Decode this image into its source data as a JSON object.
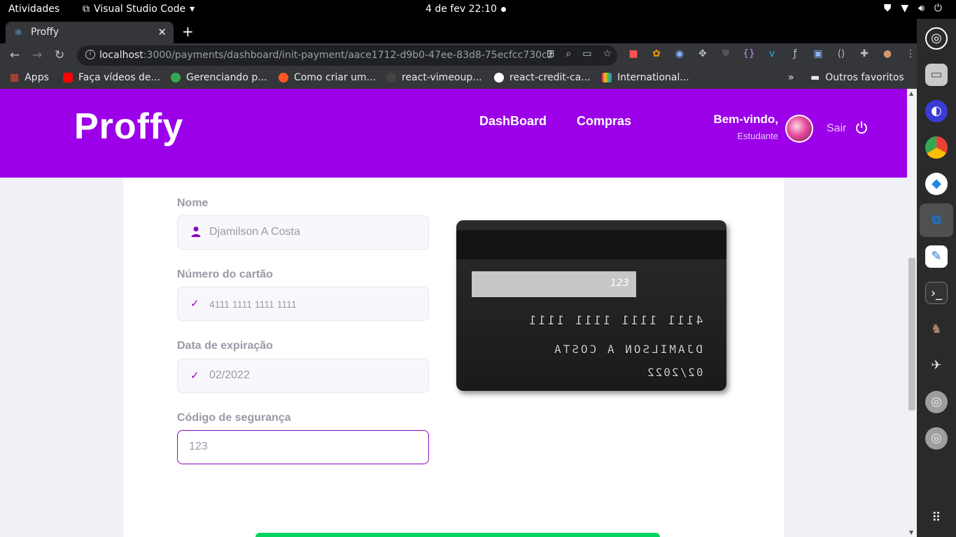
{
  "topbar": {
    "activities": "Atividades",
    "app_name": "Visual Studio Code",
    "clock": "4 de fev  22:10"
  },
  "browser": {
    "tab_title": "Proffy",
    "url_host": "localhost",
    "url_path": ":3000/payments/dashboard/init-payment/aace1712-d9b0-47ee-83d8-75ecfcc730c2",
    "bookmarks": [
      {
        "label": "Apps",
        "color": "#e8eaed"
      },
      {
        "label": "Faça vídeos de...",
        "color": "#ff0000"
      },
      {
        "label": "Gerenciando p...",
        "color": "#34a853"
      },
      {
        "label": "Como criar um...",
        "color": "#ff5722"
      },
      {
        "label": "react-vimeoup...",
        "color": "#444444"
      },
      {
        "label": "react-credit-ca...",
        "color": "#ffffff"
      },
      {
        "label": "International...",
        "color": "#e91e63"
      }
    ],
    "other_bookmarks": "Outros favoritos",
    "more": "»"
  },
  "header": {
    "logo": "Proffy",
    "nav": {
      "dashboard": "DashBoard",
      "purchases": "Compras"
    },
    "welcome": "Bem-vindo,",
    "role": "Estudante",
    "logout": "Sair"
  },
  "form": {
    "name": {
      "label": "Nome",
      "value": "Djamilson A Costa"
    },
    "number": {
      "label": "Número do cartão",
      "value": "4111 1111 1111 1111"
    },
    "expiry": {
      "label": "Data de expiração",
      "value": "02/2022"
    },
    "cvc": {
      "label": "Código de segurança",
      "value": "123"
    }
  },
  "card": {
    "cvc": "123",
    "number": "4111 1111 1111 1111",
    "holder": "DJAMILSON A COSTA",
    "expiry": "02/2022"
  },
  "colors": {
    "brand": "#9b00e8",
    "accent": "#8e05c2",
    "submit": "#04d361"
  }
}
